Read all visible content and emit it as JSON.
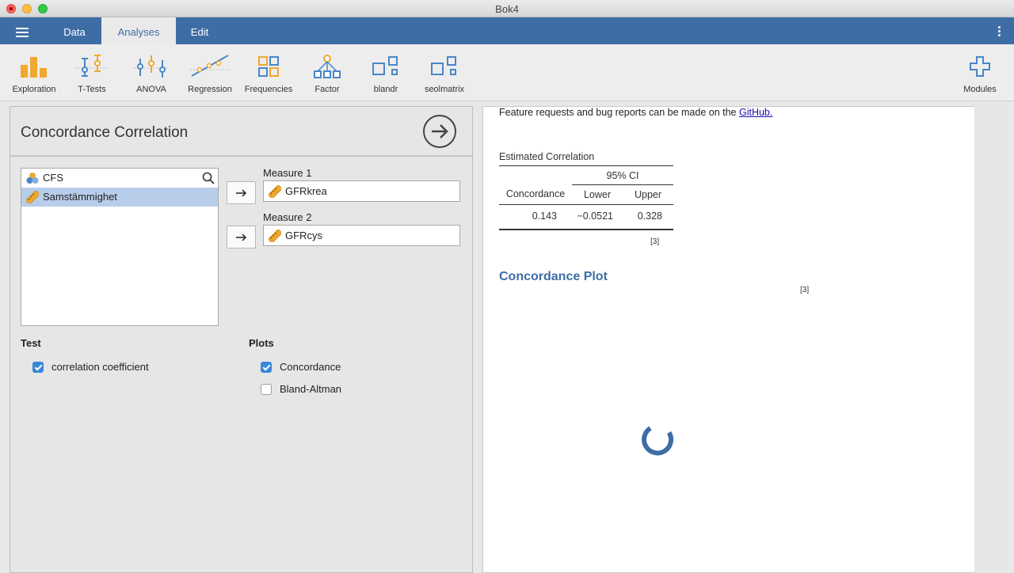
{
  "window": {
    "title": "Bok4"
  },
  "menubar": {
    "tabs": [
      {
        "label": "Data"
      },
      {
        "label": "Analyses"
      },
      {
        "label": "Edit"
      }
    ]
  },
  "ribbon": {
    "items": [
      {
        "label": "Exploration",
        "icon": "exploration-icon"
      },
      {
        "label": "T-Tests",
        "icon": "t-tests-icon"
      },
      {
        "label": "ANOVA",
        "icon": "anova-icon"
      },
      {
        "label": "Regression",
        "icon": "regression-icon"
      },
      {
        "label": "Frequencies",
        "icon": "frequencies-icon"
      },
      {
        "label": "Factor",
        "icon": "factor-icon"
      },
      {
        "label": "blandr",
        "icon": "blandr-icon"
      },
      {
        "label": "seolmatrix",
        "icon": "seolmatrix-icon"
      }
    ],
    "modules_label": "Modules"
  },
  "analysis": {
    "title": "Concordance Correlation",
    "variables": [
      {
        "name": "CFS",
        "type": "nominal"
      },
      {
        "name": "Samstämmighet",
        "type": "continuous",
        "selected": true
      }
    ],
    "measure1": {
      "label": "Measure 1",
      "value": "GFRkrea"
    },
    "measure2": {
      "label": "Measure 2",
      "value": "GFRcys"
    },
    "test": {
      "title": "Test",
      "options": [
        {
          "label": "correlation coefficient",
          "checked": true
        }
      ]
    },
    "plots": {
      "title": "Plots",
      "options": [
        {
          "label": "Concordance",
          "checked": true
        },
        {
          "label": "Bland-Altman",
          "checked": false
        }
      ]
    }
  },
  "results": {
    "note_text": "Feature requests and bug reports can be made on the ",
    "note_link": "GitHub.",
    "table": {
      "title": "Estimated Correlation",
      "ci_header": "95% CI",
      "col_concordance": "Concordance",
      "col_lower": "Lower",
      "col_upper": "Upper",
      "row": {
        "concordance": "0.143",
        "lower": "−0.0521",
        "upper": "0.328"
      },
      "footnote": "[3]"
    },
    "plot_title": "Concordance Plot",
    "plot_footnote": "[3]"
  },
  "colors": {
    "menubar": "#3e6da6",
    "accent": "#3e6da6",
    "selection": "#b8cde9",
    "ribbon_icon_orange": "#f0a830",
    "ribbon_icon_blue": "#4a86c8"
  }
}
